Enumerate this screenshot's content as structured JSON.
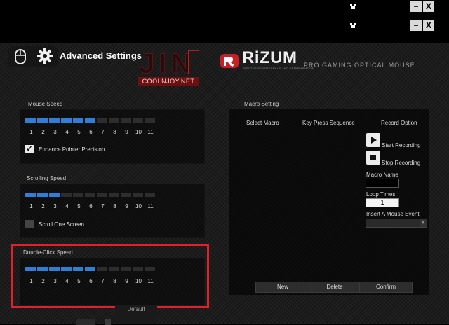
{
  "window": {
    "row1_minimize": "−",
    "row1_close": "X",
    "row2_minimize": "−",
    "row2_close": "X"
  },
  "header": {
    "title": "Advanced Settings",
    "watermark_text": "JIN",
    "watermark_sub": "COOLNJOY.NET",
    "brand_name": "RiZUM",
    "brand_tagline": "RISE THE SENSITIVITY UP AND DETERMINATION",
    "brand_product": "PRO GAMING OPTICAL MOUSE"
  },
  "mouse_speed": {
    "label": "Mouse Speed",
    "level": 6,
    "scale": [
      "1",
      "2",
      "3",
      "4",
      "5",
      "6",
      "7",
      "8",
      "9",
      "10",
      "11"
    ],
    "enhance_label": "Enhance Pointer Precision",
    "enhance_checked": true
  },
  "scrolling_speed": {
    "label": "Scrolling Speed",
    "level": 3,
    "scale": [
      "1",
      "2",
      "3",
      "4",
      "5",
      "6",
      "7",
      "8",
      "9",
      "10",
      "11"
    ],
    "one_screen_label": "Scroll One Screen",
    "one_screen_checked": false
  },
  "double_click_speed": {
    "label": "Double-Click Speed",
    "level": 6,
    "scale": [
      "1",
      "2",
      "3",
      "4",
      "5",
      "6",
      "7",
      "8",
      "9",
      "10",
      "11"
    ]
  },
  "macro": {
    "label": "Macro Setting",
    "col_select": "Select Macro",
    "col_key": "Key Press Sequence",
    "col_record": "Record Option",
    "start_recording": "Start Recording",
    "stop_recording": "Stop Recording",
    "macro_name_label": "Macro Name",
    "macro_name_value": "",
    "loop_times_label": "Loop Times",
    "loop_times_value": "1",
    "insert_event_label": "Insert A Mouse Event",
    "insert_event_value": "",
    "btn_new": "New",
    "btn_delete": "Delete",
    "btn_confirm": "Confirm"
  },
  "footer": {
    "default_label": "Default"
  },
  "colors": {
    "accent_blue": "#2f7fd6",
    "highlight_red": "#e0202a"
  }
}
